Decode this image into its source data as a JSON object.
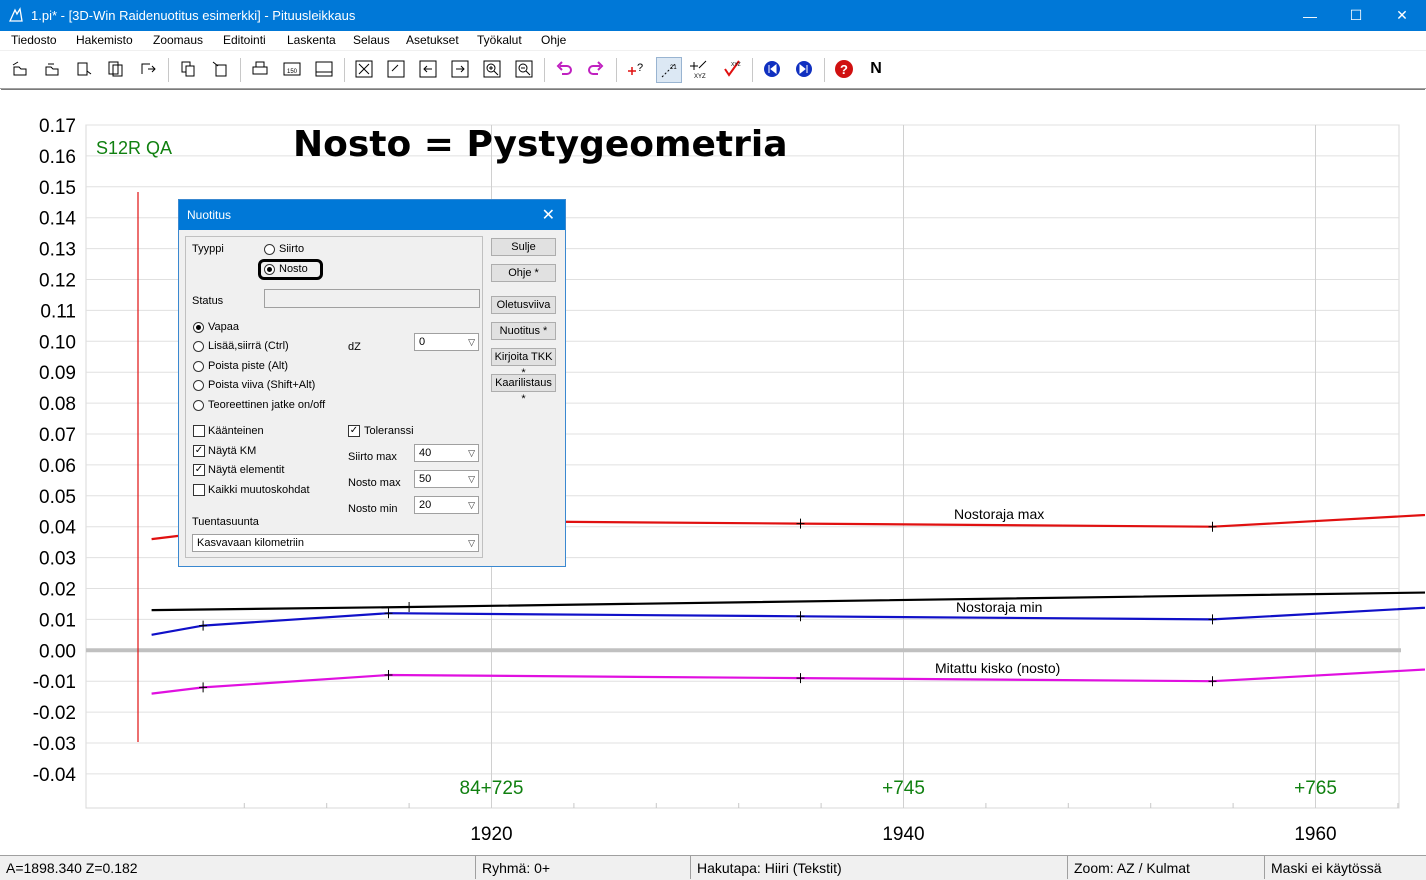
{
  "window": {
    "title": "1.pi* - [3D-Win Raidenuotitus esimerkki] - Pituusleikkaus",
    "minimize": "—",
    "maximize": "☐",
    "close": "✕"
  },
  "menu": [
    "Tiedosto",
    "Hakemisto",
    "Zoomaus",
    "Editointi",
    "Laskenta",
    "Selaus",
    "Asetukset",
    "Työkalut",
    "Ohje"
  ],
  "toolbar": {
    "n_label": "N"
  },
  "plot": {
    "heading": "Nosto = Pystygeometria",
    "track_label": "S12R QA",
    "y_ticks": [
      "0.17",
      "0.16",
      "0.15",
      "0.14",
      "0.13",
      "0.12",
      "0.11",
      "0.10",
      "0.09",
      "0.08",
      "0.07",
      "0.06",
      "0.05",
      "0.04",
      "0.03",
      "0.02",
      "0.01",
      "0.00",
      "-0.01",
      "-0.02",
      "-0.03",
      "-0.04"
    ],
    "x_ticks": [
      "1920",
      "1940",
      "1960"
    ],
    "km_labels": [
      "84+725",
      "+745",
      "+765"
    ],
    "line_labels": {
      "max": "Nostoraja max",
      "min": "Nostoraja min",
      "measured": "Mitattu kisko (nosto)"
    },
    "colors": {
      "max": "#e01010",
      "min": "#1010c8",
      "grade": "#000000",
      "measured": "#e010e0",
      "zero": "#c0c0c0",
      "green": "#108010"
    }
  },
  "chart_data": {
    "type": "line",
    "title": "Nosto = Pystygeometria",
    "xlabel": "",
    "ylabel": "",
    "xlim": [
      1903.5,
      1968.6
    ],
    "ylim": [
      -0.045,
      0.17
    ],
    "grid": true,
    "series": [
      {
        "name": "Nostoraja max",
        "x": [
          1903.5,
          1906,
          1915,
          1935,
          1955,
          1968.6
        ],
        "y": [
          0.036,
          0.038,
          0.042,
          0.041,
          0.04,
          0.045
        ]
      },
      {
        "name": "Nostoraja min",
        "x": [
          1903.5,
          1906,
          1915,
          1935,
          1955,
          1968.6
        ],
        "y": [
          0.005,
          0.008,
          0.012,
          0.011,
          0.01,
          0.015
        ]
      },
      {
        "name": "",
        "x": [
          1903.5,
          1916,
          1968.6
        ],
        "y": [
          0.013,
          0.014,
          0.019
        ]
      },
      {
        "name": "Mitattu kisko (nosto)",
        "x": [
          1903.5,
          1906,
          1915,
          1935,
          1955,
          1968.6
        ],
        "y": [
          -0.014,
          -0.012,
          -0.008,
          -0.009,
          -0.01,
          -0.005
        ]
      }
    ]
  },
  "dialog": {
    "title": "Nuotitus",
    "tyyppi_label": "Tyyppi",
    "siirto": "Siirto",
    "nosto": "Nosto",
    "status_label": "Status",
    "modes": [
      "Vapaa",
      "Lisää,siirrä  (Ctrl)",
      "Poista piste  (Alt)",
      "Poista viiva  (Shift+Alt)",
      "Teoreettinen jatke on/off"
    ],
    "dz_label": "dZ",
    "dz_value": "0",
    "checks": [
      "Käänteinen",
      "Näytä KM",
      "Näytä elementit",
      "Kaikki muutoskohdat"
    ],
    "toleranssi": "Toleranssi",
    "siirto_max_label": "Siirto max",
    "siirto_max": "40",
    "nosto_max_label": "Nosto max",
    "nosto_max": "50",
    "nosto_min_label": "Nosto min",
    "nosto_min": "20",
    "tuentasuunta_label": "Tuentasuunta",
    "tuentasuunta": "Kasvavaan kilometriin",
    "buttons": [
      "Sulje",
      "Ohje *",
      "Oletusviiva",
      "Nuotitus *",
      "Kirjoita TKK *",
      "Kaarilistaus *"
    ]
  },
  "status": {
    "coords": "A=1898.340  Z=0.182",
    "group": "Ryhmä: 0+",
    "search": "Hakutapa: Hiiri (Tekstit)",
    "zoom": "Zoom: AZ  /  Kulmat",
    "mask": "Maski ei käytössä"
  }
}
